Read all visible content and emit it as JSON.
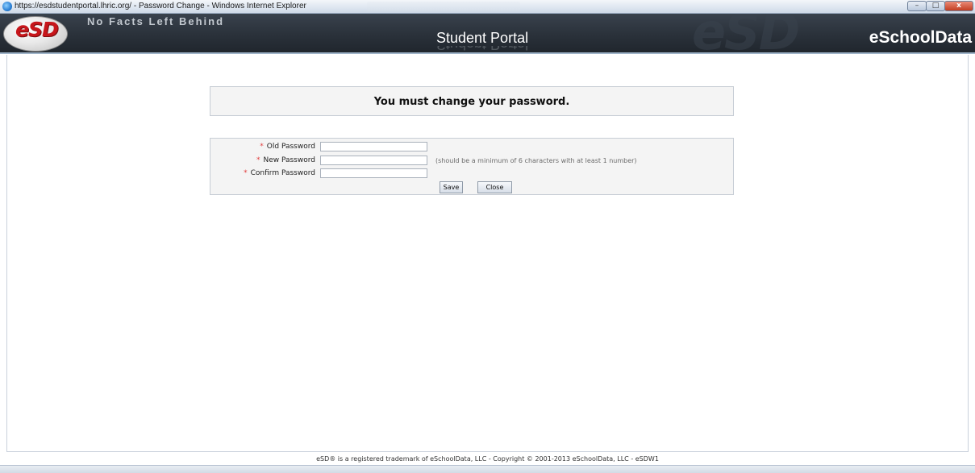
{
  "window": {
    "title": "https://esdstudentportal.lhric.org/ - Password Change - Windows Internet Explorer",
    "controls": {
      "minimize": "–",
      "maximize": "□",
      "close": "x"
    }
  },
  "header": {
    "logo_text": "eSD",
    "tagline": "No Facts Left Behind",
    "portal_title": "Student Portal",
    "watermark": "eSD",
    "brand": "eSchoolData"
  },
  "notice": {
    "message": "You must change your password."
  },
  "form": {
    "required_marker": "*",
    "old_password": {
      "label": "Old Password",
      "value": ""
    },
    "new_password": {
      "label": "New Password",
      "value": "",
      "hint": "(should be a minimum of 6 characters with at least 1 number)"
    },
    "confirm_password": {
      "label": "Confirm Password",
      "value": ""
    },
    "save_label": "Save",
    "close_label": "Close"
  },
  "footer": {
    "text": "eSD® is a registered trademark of eSchoolData, LLC - Copyright © 2001-2013 eSchoolData, LLC - eSDW1"
  },
  "colors": {
    "header_bg": "#2b323b",
    "logo_red": "#c7161b",
    "required_red": "#e23b3b",
    "panel_bg": "#f4f4f4"
  }
}
